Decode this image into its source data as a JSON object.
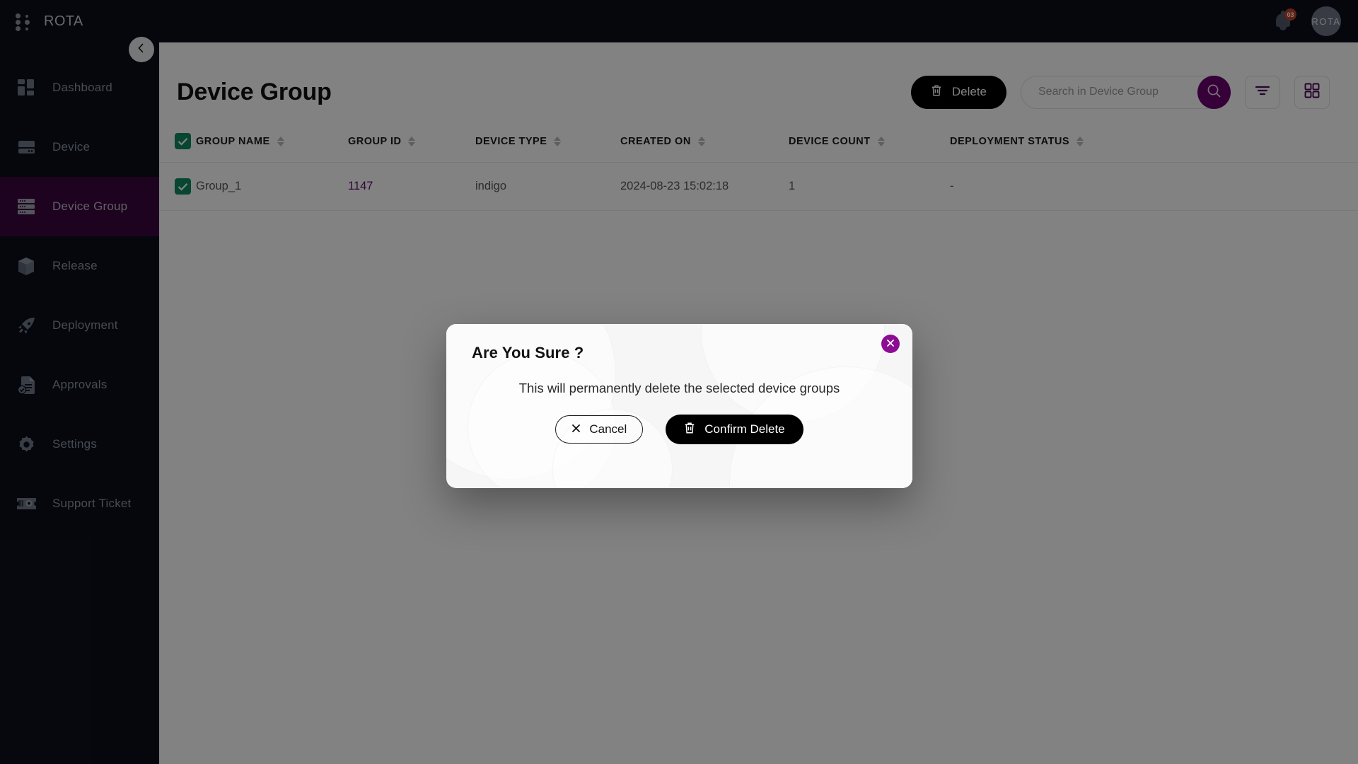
{
  "app": {
    "brand": "ROTA",
    "avatar_initials": "ROTA",
    "notification_count": "03",
    "accent_purple": "#6a006f",
    "close_purple": "#8c0d93",
    "sidebar_bg": "#0b0f1a",
    "active_nav_bg": "#3c0640",
    "checkbox_green": "#0f8a5f"
  },
  "sidebar": {
    "items": [
      {
        "label": "Dashboard",
        "icon": "dashboard-icon",
        "active": false
      },
      {
        "label": "Device",
        "icon": "device-icon",
        "active": false
      },
      {
        "label": "Device Group",
        "icon": "device-group-icon",
        "active": true
      },
      {
        "label": "Release",
        "icon": "release-box-icon",
        "active": false
      },
      {
        "label": "Deployment",
        "icon": "rocket-icon",
        "active": false
      },
      {
        "label": "Approvals",
        "icon": "approval-doc-icon",
        "active": false
      },
      {
        "label": "Settings",
        "icon": "gear-icon",
        "active": false
      },
      {
        "label": "Support Ticket",
        "icon": "ticket-icon",
        "active": false
      }
    ],
    "collapse_icon": "chevron-left-icon"
  },
  "page": {
    "title": "Device Group",
    "delete_button": "Delete",
    "search_placeholder": "Search in Device Group",
    "search_value": "",
    "filter_icon": "filter-icon",
    "grid_icon": "grid-view-icon"
  },
  "table": {
    "columns": [
      {
        "label": "GROUP NAME",
        "sortable": true
      },
      {
        "label": "GROUP ID",
        "sortable": true
      },
      {
        "label": "DEVICE TYPE",
        "sortable": true
      },
      {
        "label": "CREATED ON",
        "sortable": true
      },
      {
        "label": "DEVICE COUNT",
        "sortable": true
      },
      {
        "label": "DEPLOYMENT STATUS",
        "sortable": true
      }
    ],
    "header_checked": true,
    "rows": [
      {
        "checked": true,
        "group_name": "Group_1",
        "group_id": "1147",
        "device_type": "indigo",
        "created_on": "2024-08-23 15:02:18",
        "device_count": "1",
        "deployment_status": "-"
      }
    ]
  },
  "modal": {
    "title": "Are You Sure ?",
    "message": "This will permanently delete the selected device groups",
    "cancel_label": "Cancel",
    "confirm_label": "Confirm Delete",
    "close_icon": "close-icon",
    "cancel_icon": "x-icon",
    "confirm_icon": "trash-icon"
  }
}
